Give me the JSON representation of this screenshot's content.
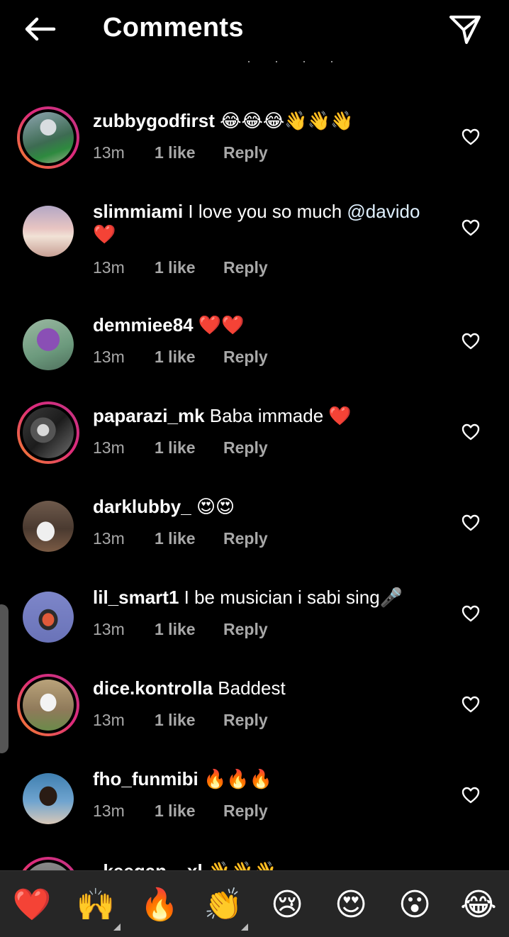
{
  "header": {
    "title": "Comments",
    "back_icon": "back-arrow-icon",
    "share_icon": "paper-plane-icon"
  },
  "previous_reply_fragment": "· · · ·",
  "comments": [
    {
      "username": "zubbygodfirst",
      "text": "😂😂😂👋👋👋",
      "time": "13m",
      "likes": "1 like",
      "reply": "Reply",
      "ring": true
    },
    {
      "username": "slimmiami",
      "text": "I love you so much ",
      "mention": "@davido",
      "text_after": " ❤️",
      "time": "13m",
      "likes": "1 like",
      "reply": "Reply",
      "ring": false
    },
    {
      "username": "demmiee84",
      "text": "❤️❤️",
      "time": "13m",
      "likes": "1 like",
      "reply": "Reply",
      "ring": false
    },
    {
      "username": "paparazi_mk",
      "text": "Baba immade ❤️",
      "time": "13m",
      "likes": "1 like",
      "reply": "Reply",
      "ring": true
    },
    {
      "username": "darklubby_",
      "text": "😍😍",
      "time": "13m",
      "likes": "1 like",
      "reply": "Reply",
      "ring": false
    },
    {
      "username": "lil_smart1",
      "text": "I be musician i sabi sing🎤",
      "time": "13m",
      "likes": "1 like",
      "reply": "Reply",
      "ring": false
    },
    {
      "username": "dice.kontrolla",
      "text": "Baddest",
      "time": "13m",
      "likes": "1 like",
      "reply": "Reply",
      "ring": true
    },
    {
      "username": "fho_funmibi",
      "text": "🔥🔥🔥",
      "time": "13m",
      "likes": "1 like",
      "reply": "Reply",
      "ring": false
    },
    {
      "username": "_keegan__xl",
      "text": "👋👋👋",
      "ring": true
    }
  ],
  "emoji_bar": [
    "❤️",
    "🙌",
    "🔥",
    "👏",
    "😢",
    "😍",
    "😮",
    "😂"
  ],
  "colors": {
    "background": "#000000",
    "meta_text": "#a8a8a8",
    "emoji_bar_bg": "#262626",
    "heart": "#ed4956"
  }
}
